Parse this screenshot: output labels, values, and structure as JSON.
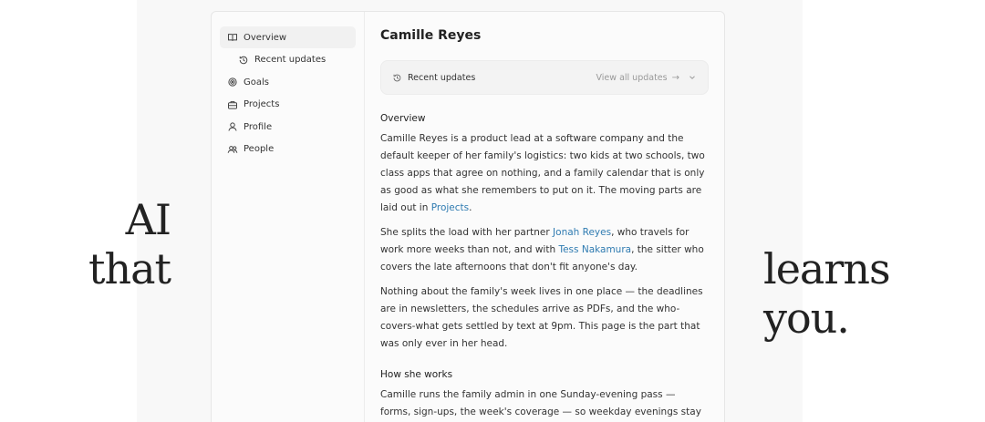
{
  "tagline": {
    "left_line1": "AI",
    "left_line2": "that",
    "right_line1": "learns",
    "right_line2": "you."
  },
  "sidebar": {
    "items": [
      {
        "label": "Overview",
        "icon": "book-open-icon",
        "active": true
      },
      {
        "label": "Recent updates",
        "icon": "history-icon",
        "sub": true
      },
      {
        "label": "Goals",
        "icon": "target-icon"
      },
      {
        "label": "Projects",
        "icon": "briefcase-icon"
      },
      {
        "label": "Profile",
        "icon": "user-icon"
      },
      {
        "label": "People",
        "icon": "users-icon"
      }
    ]
  },
  "main": {
    "title": "Camille Reyes",
    "updates": {
      "title": "Recent updates",
      "link": "View all updates",
      "arrow": "→"
    },
    "overview": {
      "heading": "Overview",
      "p1_a": "Camille Reyes is a product lead at a software company and the default keeper of her family's logistics: two kids at two schools, two class apps that agree on nothing, and a family calendar that is only as good as what she remembers to put on it. The moving parts are laid out in ",
      "p1_link": "Projects",
      "p1_b": ".",
      "p2_a": "She splits the load with her partner ",
      "p2_link1": "Jonah Reyes",
      "p2_b": ", who travels for work more weeks than not, and with ",
      "p2_link2": "Tess Nakamura",
      "p2_c": ", the sitter who covers the late afternoons that don't fit anyone's day.",
      "p3": "Nothing about the family's week lives in one place — the deadlines are in newsletters, the schedules arrive as PDFs, and the who-covers-what gets settled by text at 9pm. This page is the part that was only ever in her head."
    },
    "how": {
      "heading": "How she works",
      "p1": "Camille runs the family admin in one Sunday-evening pass — forms, sign-ups, the week's coverage — so weekday evenings stay clear."
    }
  }
}
